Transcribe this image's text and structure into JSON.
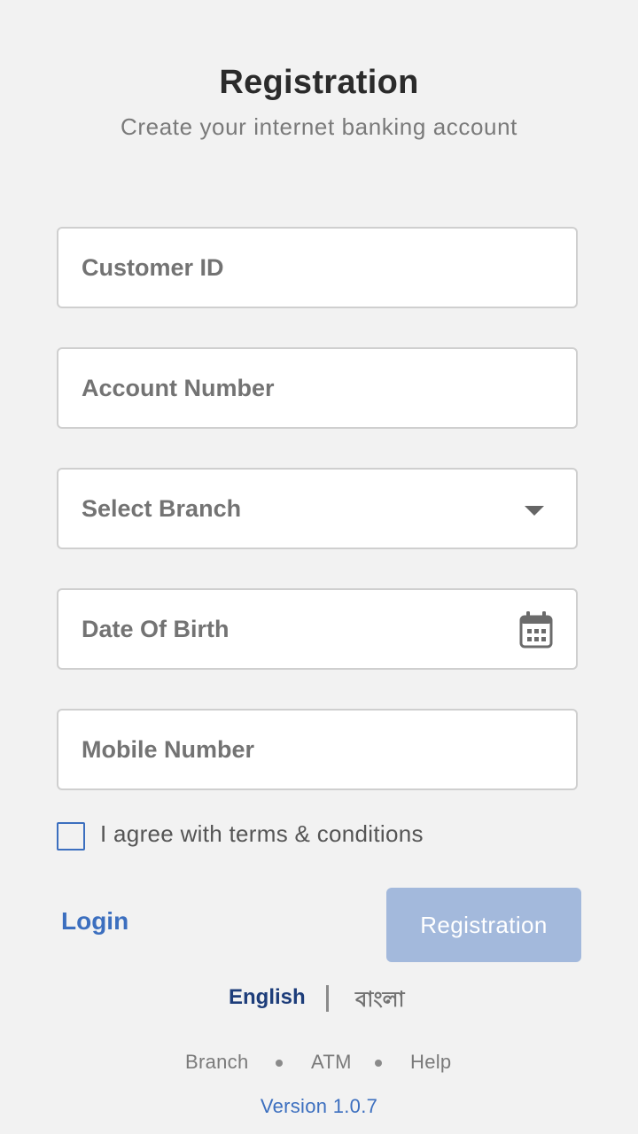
{
  "header": {
    "title": "Registration",
    "subtitle": "Create your internet banking account"
  },
  "form": {
    "customer_id": {
      "placeholder": "Customer ID",
      "value": ""
    },
    "account_number": {
      "placeholder": "Account Number",
      "value": ""
    },
    "branch": {
      "selected": "Select Branch",
      "icon": "caret-down-icon"
    },
    "dob": {
      "placeholder": "Date Of Birth",
      "icon": "calendar-icon"
    },
    "mobile": {
      "placeholder": "Mobile Number",
      "value": ""
    },
    "terms_label": "I agree with terms & conditions",
    "terms_checked": false
  },
  "actions": {
    "login_label": "Login",
    "register_label": "Registration"
  },
  "language": {
    "english": "English",
    "bangla": "বাংলা",
    "active": "English"
  },
  "footer": {
    "links": [
      "Branch",
      "ATM",
      "Help"
    ],
    "version": "Version 1.0.7"
  },
  "colors": {
    "background": "#f2f2f2",
    "accent": "#3c6fbf",
    "button_disabled": "#a3b9dc",
    "active_language": "#1d3d7a"
  }
}
